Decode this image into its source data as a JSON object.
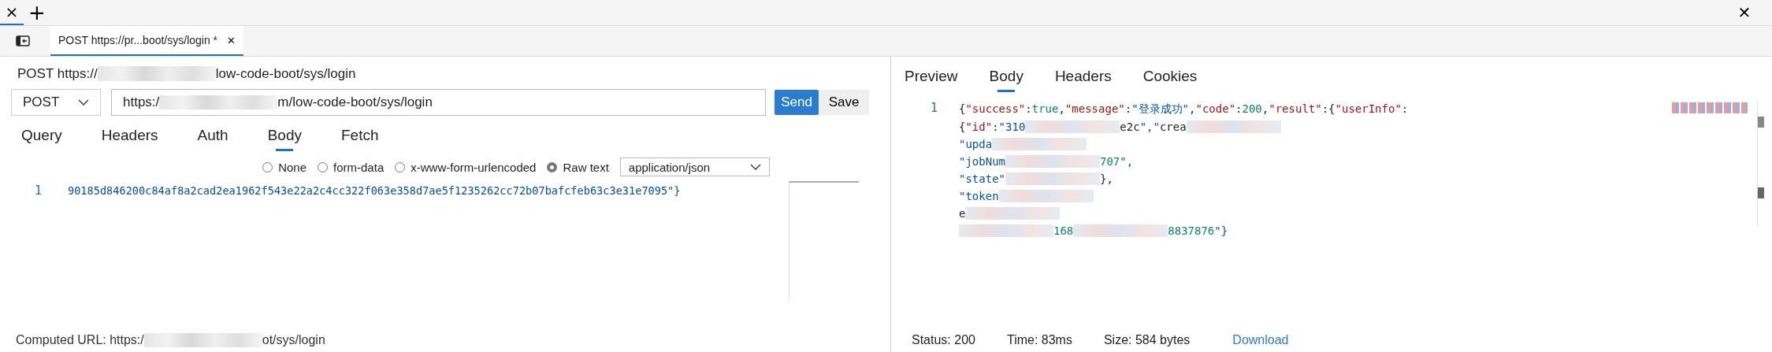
{
  "top_bar": {
    "tab_close": "×",
    "new_tab": "+",
    "window_close": "✕"
  },
  "request_tab": {
    "label": "POST https://pr...boot/sys/login *",
    "close": "✕",
    "selected": true
  },
  "request": {
    "title": [
      {
        "kind": "text",
        "text": "POST https://"
      },
      {
        "kind": "redacted"
      },
      {
        "kind": "text",
        "text": "low-code-boot/sys/login"
      }
    ],
    "method": "POST",
    "url": [
      {
        "kind": "text",
        "text": "https:/"
      },
      {
        "kind": "redacted"
      },
      {
        "kind": "text",
        "text": "m/low-code-boot/sys/login"
      }
    ],
    "send": "Send",
    "save": "Save",
    "tabs": [
      {
        "label": "Query",
        "selected": false
      },
      {
        "label": "Headers",
        "selected": false
      },
      {
        "label": "Auth",
        "selected": false
      },
      {
        "label": "Body",
        "selected": true
      },
      {
        "label": "Fetch",
        "selected": false
      }
    ],
    "body_types": [
      {
        "label": "None",
        "selected": false
      },
      {
        "label": "form-data",
        "selected": false
      },
      {
        "label": "x-www-form-urlencoded",
        "selected": false
      },
      {
        "label": "Raw text",
        "selected": true
      }
    ],
    "content_type": "application/json",
    "editor_lines": [
      {
        "number": "1",
        "text": "90185d846200c84af8a2cad2ea1962f543e22a2c4cc322f063e358d7ae5f1235262cc72b07bafcfeb63c3e31e7095\"}"
      }
    ],
    "computed_url": [
      {
        "kind": "text",
        "text": "Computed URL: https:/"
      },
      {
        "kind": "redacted"
      },
      {
        "kind": "text",
        "text": "ot/sys/login"
      }
    ]
  },
  "response": {
    "tabs": [
      {
        "label": "Preview",
        "selected": false
      },
      {
        "label": "Body",
        "selected": true
      },
      {
        "label": "Headers",
        "selected": false
      },
      {
        "label": "Cookies",
        "selected": false
      }
    ],
    "line_number": "1",
    "lines": [
      [
        {
          "kind": "text",
          "text": "{\"success\":true,\"message\":\"登录成功\",\"code\":200,\"result\":{\"userInfo\":"
        }
      ],
      [
        {
          "kind": "text",
          "text": "{\"id\":\"310"
        },
        {
          "kind": "redacted"
        },
        {
          "kind": "text",
          "text": "e2c\",\"crea"
        },
        {
          "kind": "redacted"
        }
      ],
      [
        {
          "kind": "text",
          "text": "\"upda"
        },
        {
          "kind": "redacted"
        }
      ],
      [
        {
          "kind": "text",
          "text": "\"jobNum"
        },
        {
          "kind": "redacted"
        },
        {
          "kind": "text",
          "text": "707\","
        }
      ],
      [
        {
          "kind": "text",
          "text": "\"state\""
        },
        {
          "kind": "redacted"
        },
        {
          "kind": "text",
          "text": "},"
        }
      ],
      [
        {
          "kind": "text",
          "text": "\"token"
        },
        {
          "kind": "redacted"
        }
      ],
      [
        {
          "kind": "text",
          "text": "e"
        },
        {
          "kind": "redacted"
        }
      ],
      [
        {
          "kind": "redacted"
        },
        {
          "kind": "text",
          "text": "168"
        },
        {
          "kind": "redacted"
        },
        {
          "kind": "text",
          "text": "8837876\"}"
        }
      ]
    ],
    "status": "Status: 200",
    "time": "Time: 83ms",
    "size": "Size: 584 bytes",
    "download": "Download"
  }
}
